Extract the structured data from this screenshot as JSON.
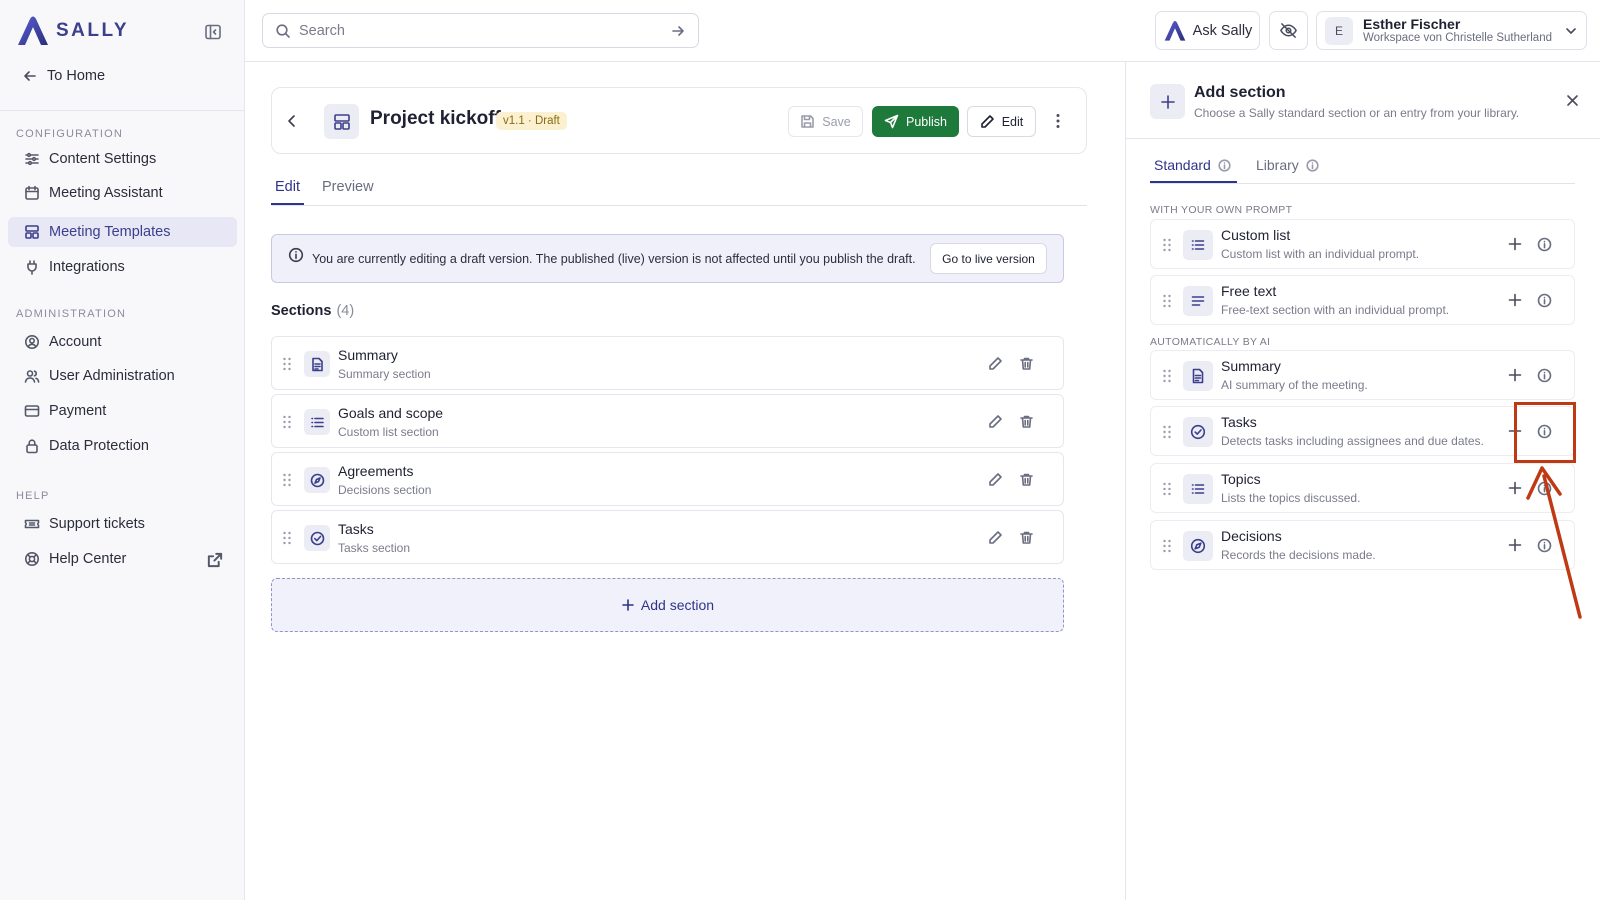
{
  "app": {
    "brand": "SALLY"
  },
  "sidebar": {
    "home": "To Home",
    "groups": [
      {
        "heading": "CONFIGURATION",
        "items": [
          {
            "label": "Content Settings",
            "icon": "sliders-icon"
          },
          {
            "label": "Meeting Assistant",
            "icon": "calendar-icon"
          },
          {
            "label": "Meeting Templates",
            "icon": "template-icon",
            "active": true
          },
          {
            "label": "Integrations",
            "icon": "plug-icon"
          }
        ]
      },
      {
        "heading": "ADMINISTRATION",
        "items": [
          {
            "label": "Account",
            "icon": "user-circle-icon"
          },
          {
            "label": "User Administration",
            "icon": "users-icon"
          },
          {
            "label": "Payment",
            "icon": "credit-card-icon"
          },
          {
            "label": "Data Protection",
            "icon": "lock-icon"
          }
        ]
      },
      {
        "heading": "HELP",
        "items": [
          {
            "label": "Support tickets",
            "icon": "ticket-icon"
          },
          {
            "label": "Help Center",
            "icon": "lifebuoy-icon"
          }
        ]
      }
    ]
  },
  "topbar": {
    "search_placeholder": "Search",
    "ask_label": "Ask Sally",
    "user": {
      "initial": "E",
      "name": "Esther Fischer",
      "workspace": "Workspace von Christelle Sutherland"
    }
  },
  "template": {
    "title": "Project kickoff",
    "badge": "v1.1 · Draft",
    "save_label": "Save",
    "publish_label": "Publish",
    "edit_label": "Edit"
  },
  "tabs": {
    "edit": "Edit",
    "preview": "Preview"
  },
  "banner": {
    "text": "You are currently editing a draft version. The published (live) version is not affected until you publish the draft.",
    "button": "Go to live version"
  },
  "sections": {
    "title": "Sections",
    "count": "(4)",
    "items": [
      {
        "name": "Summary",
        "sub": "Summary section",
        "icon": "document-icon"
      },
      {
        "name": "Goals and scope",
        "sub": "Custom list section",
        "icon": "list-icon"
      },
      {
        "name": "Agreements",
        "sub": "Decisions section",
        "icon": "compass-icon"
      },
      {
        "name": "Tasks",
        "sub": "Tasks section",
        "icon": "check-circle-icon"
      }
    ],
    "add_label": "Add section"
  },
  "panel": {
    "title": "Add section",
    "subtitle": "Choose a Sally standard section or an entry from your library.",
    "tab_standard": "Standard",
    "tab_library": "Library",
    "group_prompt": "WITH YOUR OWN PROMPT",
    "group_ai": "AUTOMATICALLY BY AI",
    "prompt_items": [
      {
        "name": "Custom list",
        "sub": "Custom list with an individual prompt.",
        "icon": "list-icon"
      },
      {
        "name": "Free text",
        "sub": "Free-text section with an individual prompt.",
        "icon": "text-lines-icon"
      }
    ],
    "ai_items": [
      {
        "name": "Summary",
        "sub": "AI summary of the meeting.",
        "icon": "document-icon"
      },
      {
        "name": "Tasks",
        "sub": "Detects tasks including assignees and due dates.",
        "icon": "check-circle-icon"
      },
      {
        "name": "Topics",
        "sub": "Lists the topics discussed.",
        "icon": "list-icon"
      },
      {
        "name": "Decisions",
        "sub": "Records the decisions made.",
        "icon": "compass-icon"
      }
    ]
  },
  "colors": {
    "brand": "#3b3f8c",
    "publish": "#1e7a3a",
    "annotation": "#bf3a14"
  }
}
